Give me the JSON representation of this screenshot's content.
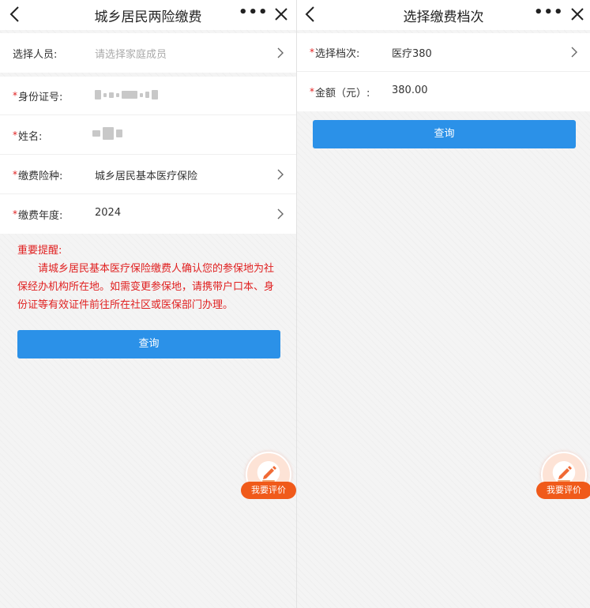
{
  "left": {
    "title": "城乡居民两险缴费",
    "more_label": "•••",
    "select_person": {
      "label": "选择人员:",
      "placeholder": "请选择家庭成员"
    },
    "fields": [
      {
        "label": "身份证号:",
        "value": "",
        "required": true
      },
      {
        "label": "姓名:",
        "value": "",
        "required": true
      },
      {
        "label": "缴费险种:",
        "value": "城乡居民基本医疗保险",
        "required": true
      },
      {
        "label": "缴费年度:",
        "value": "2024",
        "required": true
      }
    ],
    "notice": {
      "title": "重要提醒:",
      "body": "请城乡居民基本医疗保险缴费人确认您的参保地为社保经办机构所在地。如需变更参保地，请携带户口本、身份证等有效证件前往所在社区或医保部门办理。"
    },
    "query_label": "查询",
    "rate_label": "我要评价"
  },
  "right": {
    "title": "选择缴费档次",
    "more_label": "•••",
    "fields": [
      {
        "label": "选择档次:",
        "value": "医疗380",
        "required": true
      },
      {
        "label": "金额（元）:",
        "value": "380.00",
        "required": true
      }
    ],
    "query_label": "查询",
    "rate_label": "我要评价"
  },
  "colors": {
    "primary_button": "#2b91e8",
    "notice_red": "#e02020",
    "rate_orange": "#f05a1a"
  },
  "icons": [
    "back-arrow-icon",
    "more-dots-icon",
    "close-icon",
    "chevron-right-icon",
    "pencil-edit-icon"
  ]
}
